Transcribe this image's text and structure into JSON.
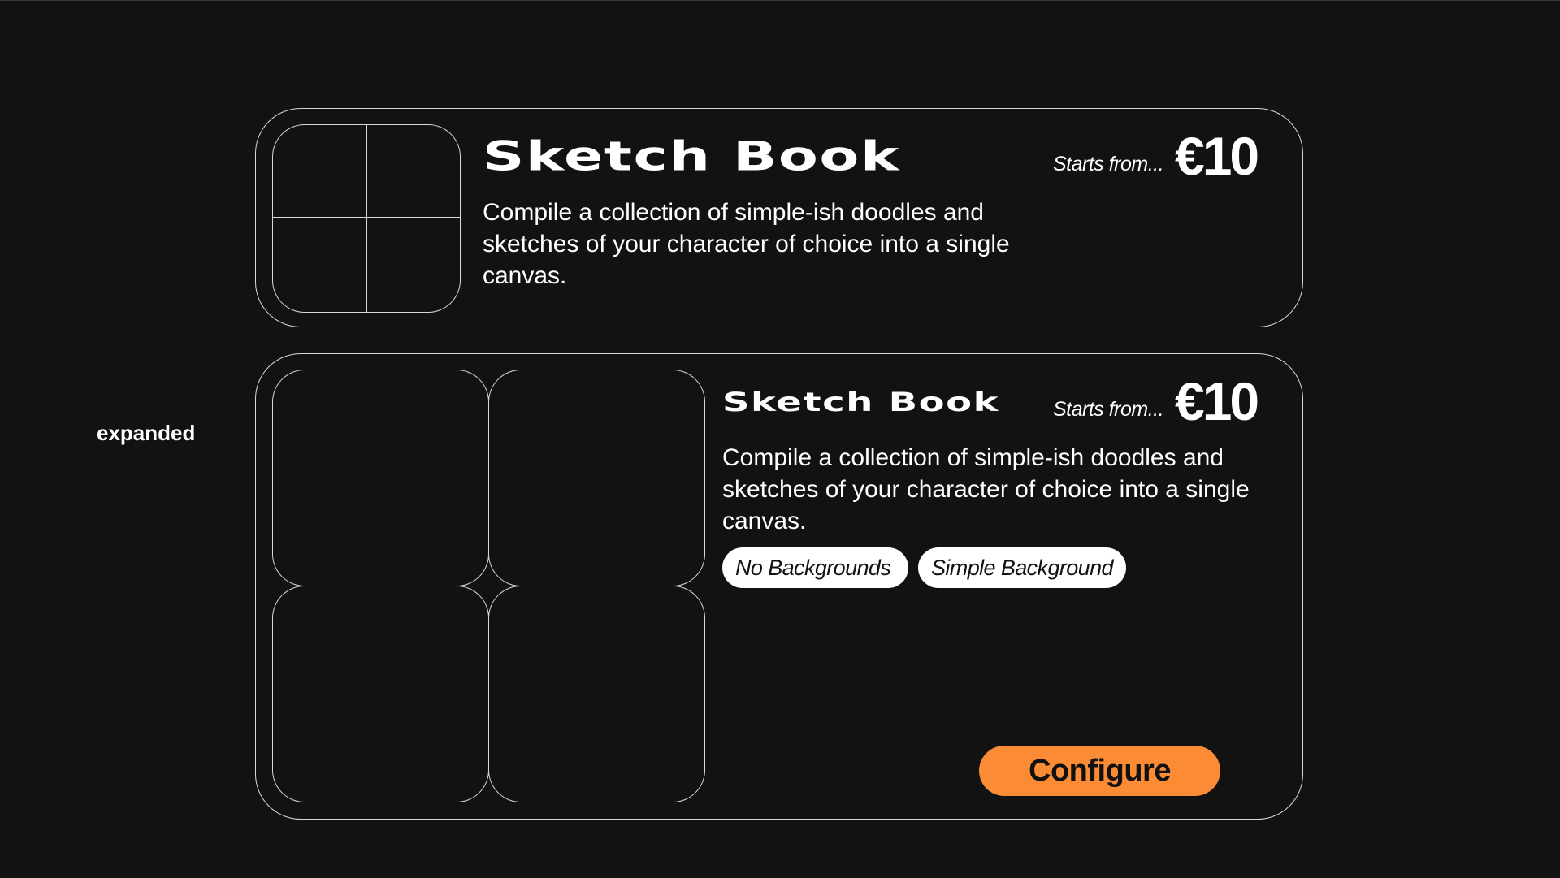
{
  "state_label": "expanded",
  "collapsed_card": {
    "title": "Sketch Book",
    "starts_from": "Starts from...",
    "price": "€10",
    "description": "Compile a collection of simple-ish doodles and sketches of your character of choice into a single canvas."
  },
  "expanded_card": {
    "title": "Sketch Book",
    "starts_from": "Starts from...",
    "price": "€10",
    "description": "Compile a collection of simple-ish doodles and sketches of your character of choice into a single canvas.",
    "options": [
      "No Backgrounds",
      "Simple Background"
    ],
    "configure_label": "Configure"
  },
  "colors": {
    "background": "#121212",
    "outline": "#d8d8d8",
    "accent": "#fb8c35"
  }
}
